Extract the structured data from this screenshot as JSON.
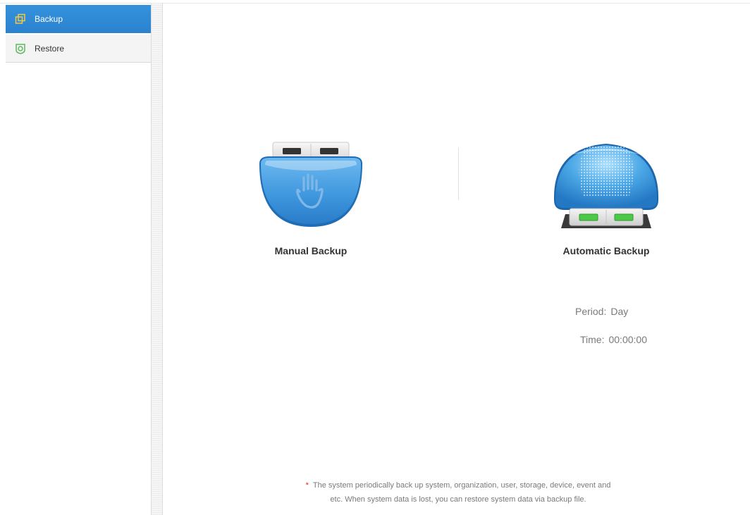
{
  "sidebar": {
    "items": [
      {
        "label": "Backup",
        "icon": "copy-icon",
        "active": true
      },
      {
        "label": "Restore",
        "icon": "restore-icon",
        "active": false
      }
    ]
  },
  "main": {
    "manual": {
      "title": "Manual Backup",
      "icon": "usb-hand-icon"
    },
    "automatic": {
      "title": "Automatic Backup",
      "icon": "usb-auto-icon",
      "period_label": "Period:",
      "period_value": "Day",
      "time_label": "Time:",
      "time_value": "00:00:00"
    },
    "note": {
      "star": "*",
      "line1": "The system periodically back up system, organization, user, storage, device, event and",
      "line2": "etc. When system data is lost, you can restore system data via backup file."
    }
  },
  "colors": {
    "accent": "#2b82cf",
    "restore_icon": "#5cb85c",
    "backup_icon": "#f0c040"
  }
}
